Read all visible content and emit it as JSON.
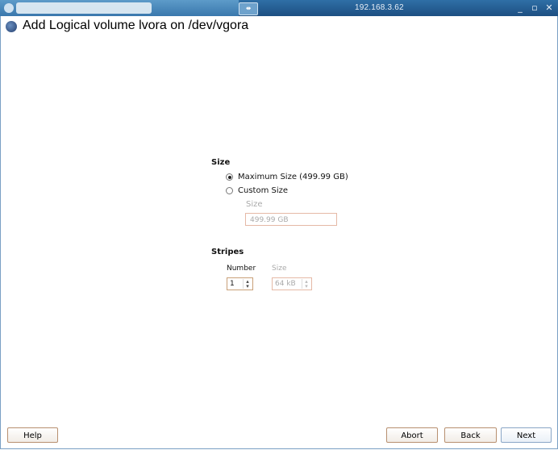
{
  "window": {
    "host": "192.168.3.62",
    "controls": {
      "minimize": "_",
      "restore": "▫",
      "close": "✕"
    }
  },
  "dialog": {
    "title": "Add Logical volume lvora on /dev/vgora"
  },
  "size_section": {
    "label": "Size",
    "options": [
      {
        "label": "Maximum Size (499.99 GB)",
        "selected": true
      },
      {
        "label": "Custom Size",
        "selected": false
      }
    ],
    "custom_size_label": "Size",
    "custom_size_value": "499.99 GB"
  },
  "stripes_section": {
    "label": "Stripes",
    "number_label": "Number",
    "number_value": "1",
    "size_label": "Size",
    "size_value": "64 kB"
  },
  "buttons": {
    "help": "Help",
    "abort": "Abort",
    "back": "Back",
    "next": "Next"
  },
  "icons": {
    "heading": "yast-disk-icon",
    "window_pin": "pin-icon"
  }
}
